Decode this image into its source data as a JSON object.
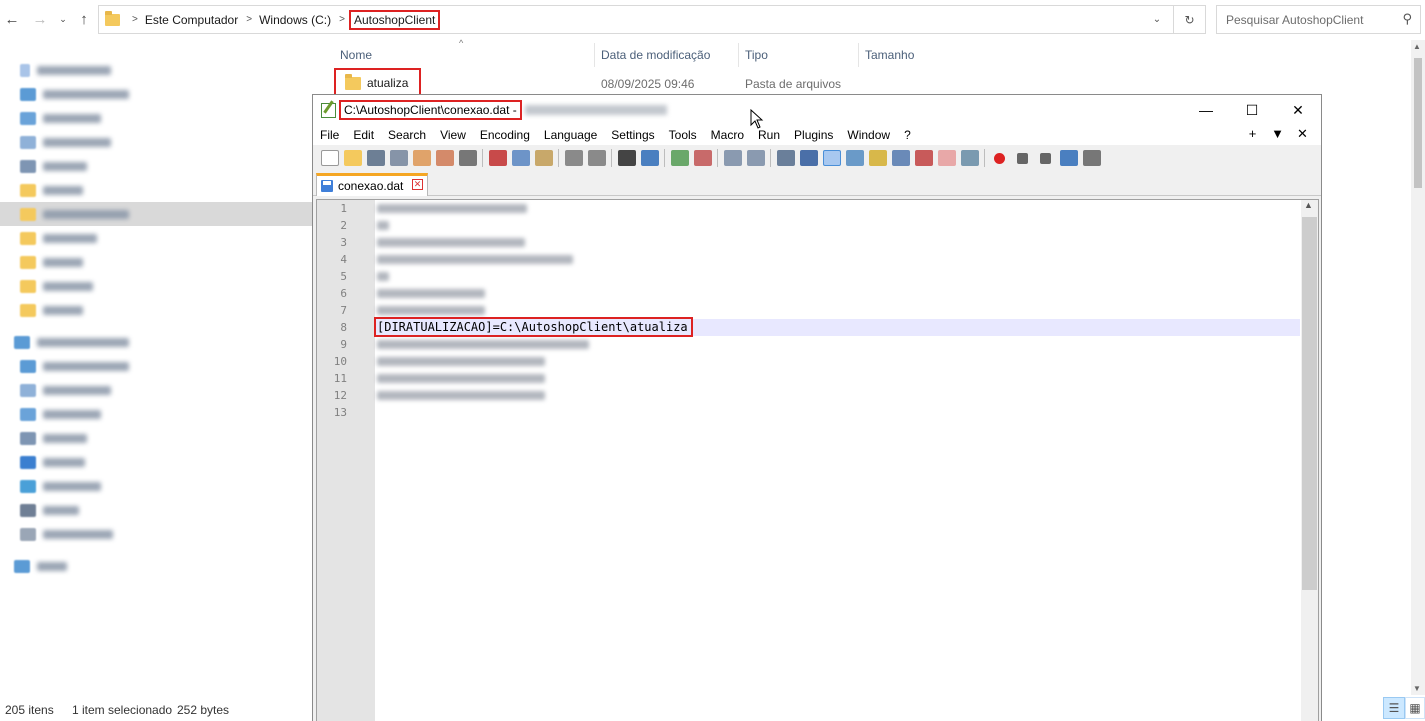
{
  "explorer": {
    "breadcrumb": [
      "Este Computador",
      "Windows (C:)",
      "AutoshopClient"
    ],
    "search_placeholder": "Pesquisar AutoshopClient",
    "columns": {
      "name": "Nome",
      "modified": "Data de modificação",
      "type": "Tipo",
      "size": "Tamanho"
    },
    "files": [
      {
        "name": "atualiza",
        "modified": "08/09/2025 09:46",
        "type": "Pasta de arquivos",
        "size": ""
      }
    ],
    "status": {
      "count": "205 itens",
      "selection": "1 item selecionado",
      "size": "252 bytes"
    }
  },
  "notepad": {
    "title": "C:\\AutoshopClient\\conexao.dat -",
    "menu": [
      "File",
      "Edit",
      "Search",
      "View",
      "Encoding",
      "Language",
      "Settings",
      "Tools",
      "Macro",
      "Run",
      "Plugins",
      "Window",
      "?"
    ],
    "menu_right": [
      "+",
      "▼",
      "✕"
    ],
    "tab_label": "conexao.dat",
    "line_numbers": [
      "1",
      "2",
      "3",
      "4",
      "5",
      "6",
      "7",
      "8",
      "9",
      "10",
      "11",
      "12",
      "13"
    ],
    "highlight_line_text": "[DIRATUALIZACAO]=C:\\AutoshopClient\\atualiza"
  },
  "colors": {
    "highlight_box": "#dd2222",
    "folder": "#f4c95d",
    "current_line": "#e8e8ff",
    "tab_accent": "#f5a623"
  }
}
